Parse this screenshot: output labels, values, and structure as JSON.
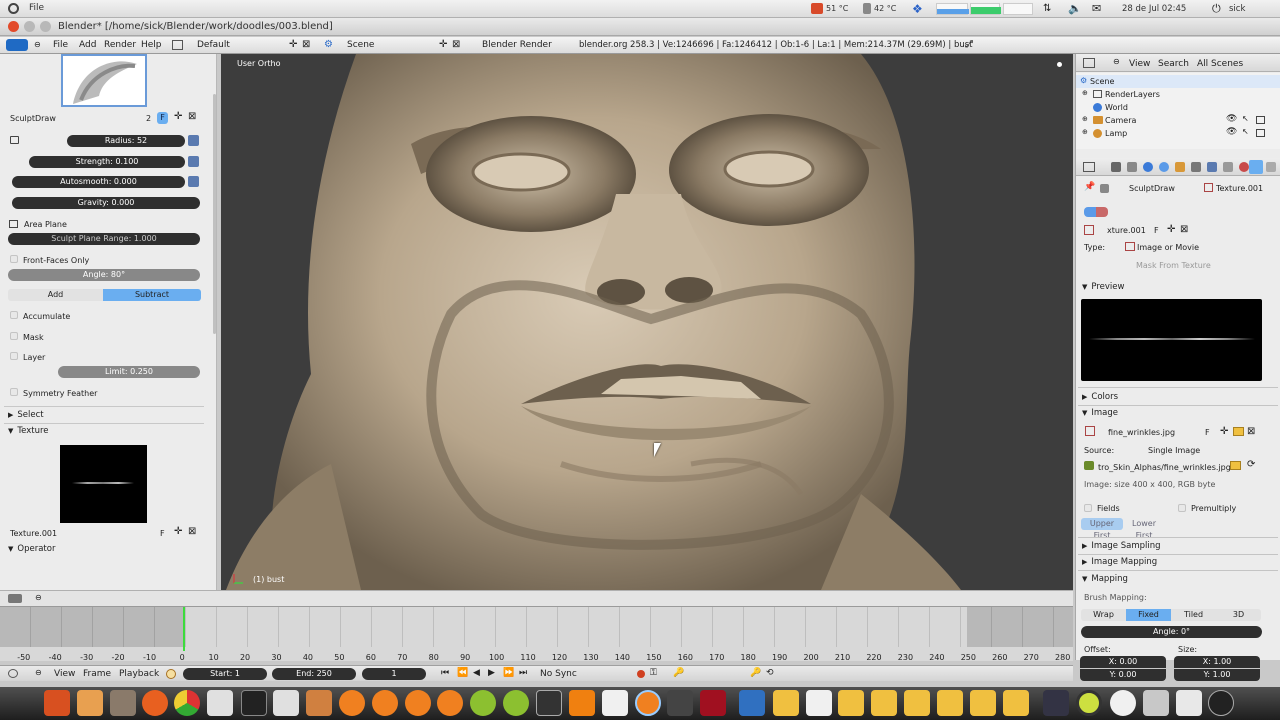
{
  "system": {
    "file_menu": "File",
    "temp1": "51 °C",
    "temp2": "42 °C",
    "date": "28 de Jul 02:45",
    "user": "sick"
  },
  "window": {
    "title": "Blender* [/home/sick/Blender/work/doodles/003.blend]"
  },
  "infobar": {
    "menus": [
      "File",
      "Add",
      "Render",
      "Help"
    ],
    "layout": "Default",
    "scene": "Scene",
    "engine": "Blender Render",
    "stats": "blender.org 258.3 | Ve:1246696 | Fa:1246412 | Ob:1-6 | La:1 | Mem:214.37M (29.69M) | bust"
  },
  "toolshelf": {
    "brush_name": "SculptDraw",
    "brush_users": "2",
    "brush_fake": "F",
    "radius": "Radius: 52",
    "strength": "Strength: 0.100",
    "autosmooth": "Autosmooth: 0.000",
    "gravity": "Gravity: 0.000",
    "area_plane": "Area Plane",
    "plane_range": "Sculpt Plane Range: 1.000",
    "front_faces": "Front-Faces Only",
    "angle": "Angle: 80°",
    "add": "Add",
    "subtract": "Subtract",
    "accumulate": "Accumulate",
    "mask": "Mask",
    "layer": "Layer",
    "limit": "Limit: 0.250",
    "symmetry_feather": "Symmetry Feather",
    "select_section": "Select",
    "texture_section": "Texture",
    "texture_name": "Texture.001",
    "texture_fake": "F",
    "operator_section": "Operator"
  },
  "viewport": {
    "view_label": "User Ortho",
    "object_label": "(1) bust"
  },
  "outliner": {
    "menus": [
      "View",
      "Search",
      "All Scenes"
    ],
    "items": [
      "Scene",
      "RenderLayers",
      "World",
      "Camera",
      "Lamp"
    ]
  },
  "properties": {
    "brush": "SculptDraw",
    "texture": "Texture.001",
    "texture_field": "xture.001",
    "texture_fake": "F",
    "type_label": "Type:",
    "type_value": "Image or Movie",
    "mask_from_texture": "Mask From Texture",
    "preview": "Preview",
    "colors": "Colors",
    "image": "Image",
    "image_name": "fine_wrinkles.jpg",
    "image_fake": "F",
    "source_label": "Source:",
    "source_value": "Single Image",
    "filepath": "tro_Skin_Alphas/fine_wrinkles.jpg",
    "image_info": "Image: size 400 x 400, RGB byte",
    "fields": "Fields",
    "premultiply": "Premultiply",
    "upper_first": "Upper First",
    "lower_first": "Lower First",
    "image_sampling": "Image Sampling",
    "image_mapping": "Image Mapping",
    "mapping": "Mapping",
    "brush_mapping": "Brush Mapping:",
    "wrap": "Wrap",
    "fixed": "Fixed",
    "tiled": "Tiled",
    "threed": "3D",
    "mapping_angle": "Angle: 0°",
    "offset": "Offset:",
    "size": "Size:",
    "offset_x": "X: 0.00",
    "offset_y": "Y: 0.00",
    "size_x": "X: 1.00",
    "size_y": "Y: 1.00"
  },
  "timeline": {
    "ticks": [
      "-50",
      "-40",
      "-30",
      "-20",
      "-10",
      "0",
      "10",
      "20",
      "30",
      "40",
      "50",
      "60",
      "70",
      "80",
      "90",
      "100",
      "110",
      "120",
      "130",
      "140",
      "150",
      "160",
      "170",
      "180",
      "190",
      "200",
      "210",
      "220",
      "230",
      "240",
      "250",
      "260",
      "270",
      "280"
    ],
    "menus": [
      "View",
      "Frame",
      "Playback"
    ],
    "start": "Start: 1",
    "end": "End: 250",
    "current": "1",
    "sync": "No Sync"
  },
  "colors": {
    "accent_blue": "#6aaef0",
    "taskbar_dark": "#2a2a2a",
    "viewport_bg": "#3d3d3d",
    "timeline_cursor": "#3cdc3c"
  }
}
